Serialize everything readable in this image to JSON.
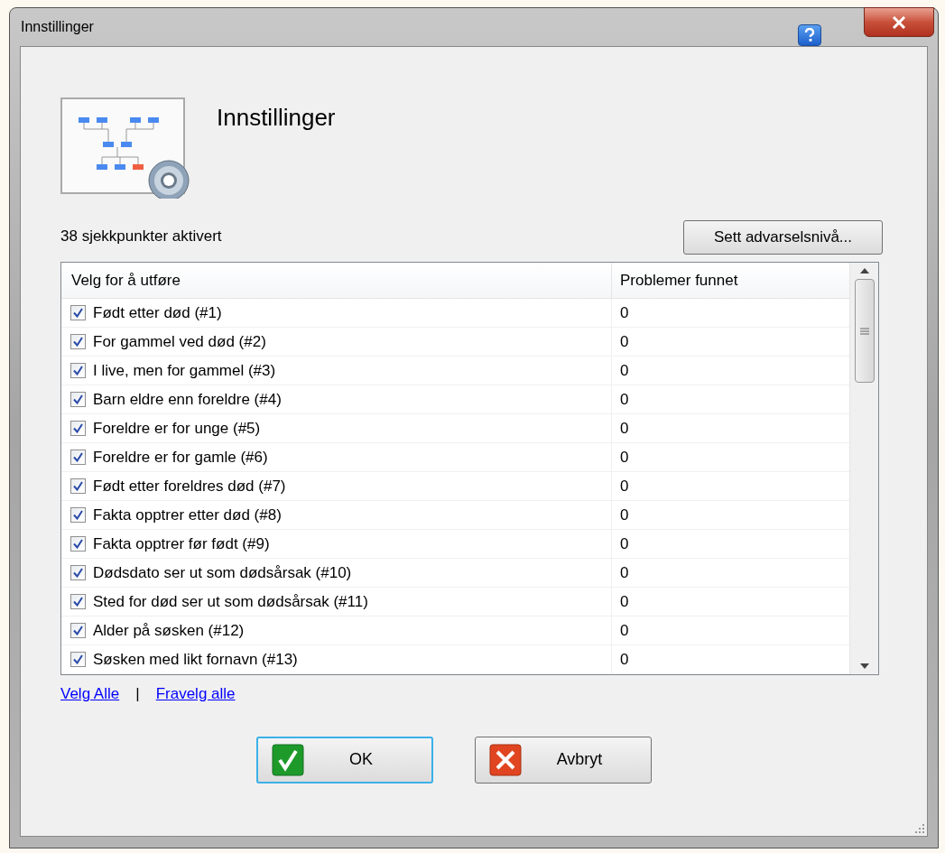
{
  "window": {
    "title": "Innstillinger"
  },
  "heading": "Innstillinger",
  "summary": "38 sjekkpunkter aktivert",
  "warning_button": "Sett advarselsnivå...",
  "table": {
    "columns": [
      "Velg for å utføre",
      "Problemer funnet"
    ],
    "rows": [
      {
        "label": "Født etter død (#1)",
        "count": "0",
        "checked": true
      },
      {
        "label": "For gammel ved død (#2)",
        "count": "0",
        "checked": true
      },
      {
        "label": "I live, men for gammel (#3)",
        "count": "0",
        "checked": true
      },
      {
        "label": "Barn eldre enn foreldre (#4)",
        "count": "0",
        "checked": true
      },
      {
        "label": "Foreldre er for unge (#5)",
        "count": "0",
        "checked": true
      },
      {
        "label": "Foreldre er for gamle (#6)",
        "count": "0",
        "checked": true
      },
      {
        "label": "Født etter foreldres død (#7)",
        "count": "0",
        "checked": true
      },
      {
        "label": "Fakta opptrer etter død (#8)",
        "count": "0",
        "checked": true
      },
      {
        "label": "Fakta opptrer før født (#9)",
        "count": "0",
        "checked": true
      },
      {
        "label": "Dødsdato ser ut som dødsårsak (#10)",
        "count": "0",
        "checked": true
      },
      {
        "label": "Sted for død ser ut som dødsårsak (#11)",
        "count": "0",
        "checked": true
      },
      {
        "label": "Alder på søsken (#12)",
        "count": "0",
        "checked": true
      },
      {
        "label": "Søsken med likt fornavn (#13)",
        "count": "0",
        "checked": true
      }
    ]
  },
  "links": [
    "Velg Alle",
    "Fravelg alle"
  ],
  "link_separator": "|",
  "buttons": [
    {
      "label": "OK",
      "kind": "ok",
      "selected": true
    },
    {
      "label": "Avbryt",
      "kind": "cancel",
      "selected": false
    }
  ]
}
